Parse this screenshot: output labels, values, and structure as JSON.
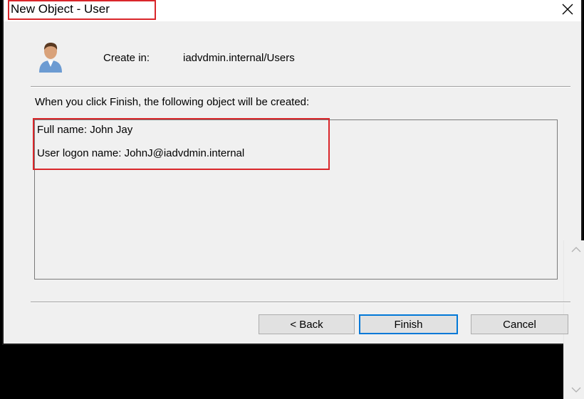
{
  "window": {
    "title": "New Object - User"
  },
  "header": {
    "create_label": "Create in:",
    "create_path": "iadvdmin.internal/Users"
  },
  "summary": {
    "intro": "When you click Finish, the following object will be created:",
    "lines": [
      "Full name: John Jay",
      "User logon name: JohnJ@iadvdmin.internal"
    ]
  },
  "buttons": {
    "back": "< Back",
    "finish": "Finish",
    "cancel": "Cancel"
  },
  "icons": {
    "close": "close-icon",
    "avatar": "user-avatar-icon",
    "scroll_up": "chevron-up-icon",
    "scroll_down": "chevron-down-icon"
  },
  "colors": {
    "highlight": "#d9262a",
    "default_button_border": "#0078d7"
  }
}
